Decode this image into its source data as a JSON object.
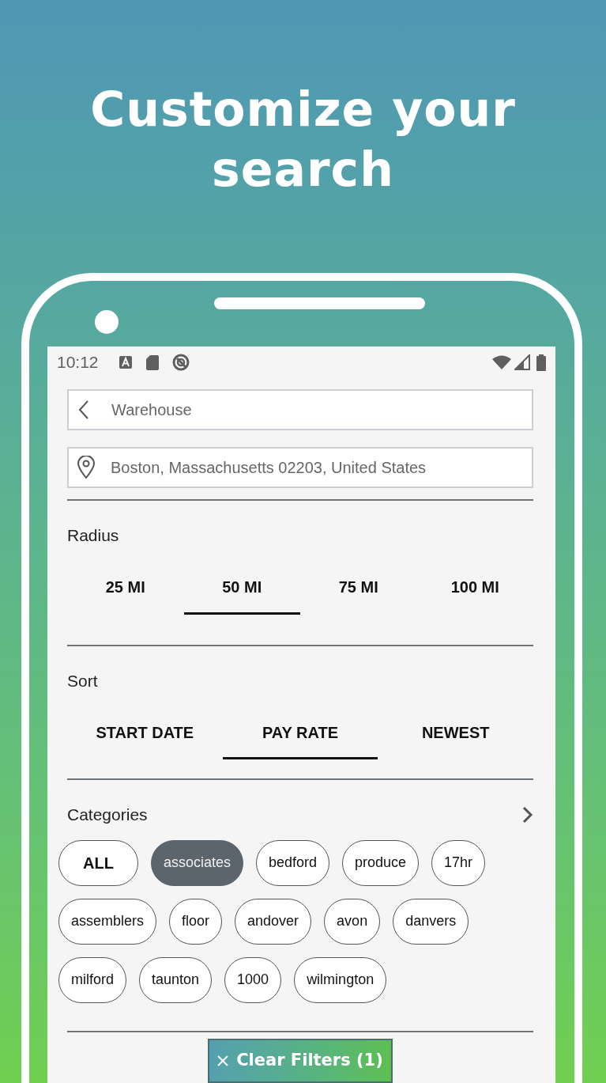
{
  "headline": "Customize your search",
  "status_bar": {
    "time": "10:12"
  },
  "search_field": {
    "value": "Warehouse"
  },
  "location_field": {
    "value": "Boston, Massachusetts 02203, United States"
  },
  "radius": {
    "title": "Radius",
    "options": [
      {
        "label": "25 MI",
        "selected": false
      },
      {
        "label": "50 MI",
        "selected": true
      },
      {
        "label": "75 MI",
        "selected": false
      },
      {
        "label": "100 MI",
        "selected": false
      }
    ]
  },
  "sort": {
    "title": "Sort",
    "options": [
      {
        "label": "START DATE",
        "selected": false
      },
      {
        "label": "PAY RATE",
        "selected": true
      },
      {
        "label": "NEWEST",
        "selected": false
      }
    ]
  },
  "categories": {
    "title": "Categories",
    "chips": [
      {
        "label": "ALL",
        "kind": "all",
        "selected": false
      },
      {
        "label": "associates",
        "kind": "tag",
        "selected": true
      },
      {
        "label": "bedford",
        "kind": "tag",
        "selected": false
      },
      {
        "label": "produce",
        "kind": "tag",
        "selected": false
      },
      {
        "label": "17hr",
        "kind": "tag",
        "selected": false
      },
      {
        "label": "assemblers",
        "kind": "tag",
        "selected": false
      },
      {
        "label": "floor",
        "kind": "tag",
        "selected": false
      },
      {
        "label": "andover",
        "kind": "tag",
        "selected": false
      },
      {
        "label": "avon",
        "kind": "tag",
        "selected": false
      },
      {
        "label": "danvers",
        "kind": "tag",
        "selected": false
      },
      {
        "label": "milford",
        "kind": "tag",
        "selected": false
      },
      {
        "label": "taunton",
        "kind": "tag",
        "selected": false
      },
      {
        "label": "1000",
        "kind": "tag",
        "selected": false
      },
      {
        "label": "wilmington",
        "kind": "tag",
        "selected": false
      }
    ]
  },
  "clear_button": {
    "label": "Clear Filters (1)"
  }
}
